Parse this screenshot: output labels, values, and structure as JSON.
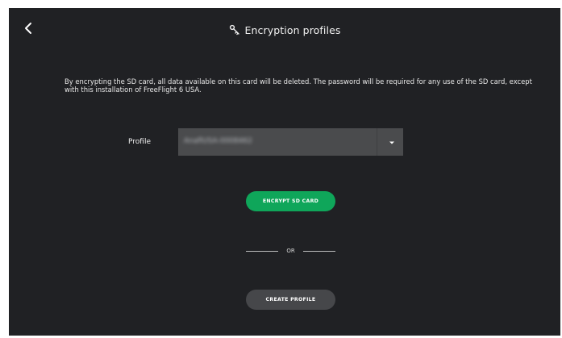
{
  "header": {
    "title": "Encryption profiles",
    "back_icon": "chevron-left-icon",
    "title_icon": "key-icon"
  },
  "description": "By encrypting the SD card, all data available on this card will be deleted. The password will be required for any use of the SD card, except with this installation of FreeFlight 6 USA.",
  "profile": {
    "label": "Profile",
    "selected_value": "AnafiUSA-0008462",
    "dropdown_icon": "caret-down-icon"
  },
  "actions": {
    "encrypt_label": "ENCRYPT SD CARD",
    "or_label": "OR",
    "create_label": "CREATE PROFILE"
  },
  "colors": {
    "background": "#202124",
    "primary_button": "#0fa65a",
    "secondary_button": "#46474a",
    "select_background": "#4a4b4d"
  }
}
